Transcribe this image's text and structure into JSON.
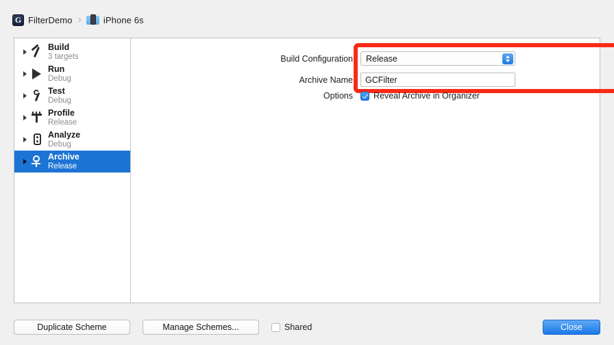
{
  "toolbar": {
    "app_icon_letter": "G",
    "project_name": "FilterDemo",
    "separator": "›",
    "device_name": "iPhone 6s"
  },
  "sidebar": {
    "items": [
      {
        "title": "Build",
        "subtitle": "3 targets",
        "icon": "hammer-icon",
        "selected": false
      },
      {
        "title": "Run",
        "subtitle": "Debug",
        "icon": "play-icon",
        "selected": false
      },
      {
        "title": "Test",
        "subtitle": "Debug",
        "icon": "wrench-icon",
        "selected": false
      },
      {
        "title": "Profile",
        "subtitle": "Release",
        "icon": "gauge-icon",
        "selected": false
      },
      {
        "title": "Analyze",
        "subtitle": "Debug",
        "icon": "analyze-icon",
        "selected": false
      },
      {
        "title": "Archive",
        "subtitle": "Release",
        "icon": "archive-icon",
        "selected": true
      }
    ]
  },
  "form": {
    "build_configuration_label": "Build Configuration",
    "build_configuration_value": "Release",
    "archive_name_label": "Archive Name",
    "archive_name_value": "GCFilter",
    "options_label": "Options",
    "reveal_archive_label": "Reveal Archive in Organizer",
    "reveal_archive_checked": true
  },
  "footer": {
    "duplicate_scheme_label": "Duplicate Scheme",
    "manage_schemes_label": "Manage Schemes...",
    "shared_label": "Shared",
    "shared_checked": false,
    "close_label": "Close"
  },
  "colors": {
    "selection_blue": "#1c74d4",
    "highlight_red": "#f92a16",
    "default_button_blue": "#1a78e8"
  }
}
